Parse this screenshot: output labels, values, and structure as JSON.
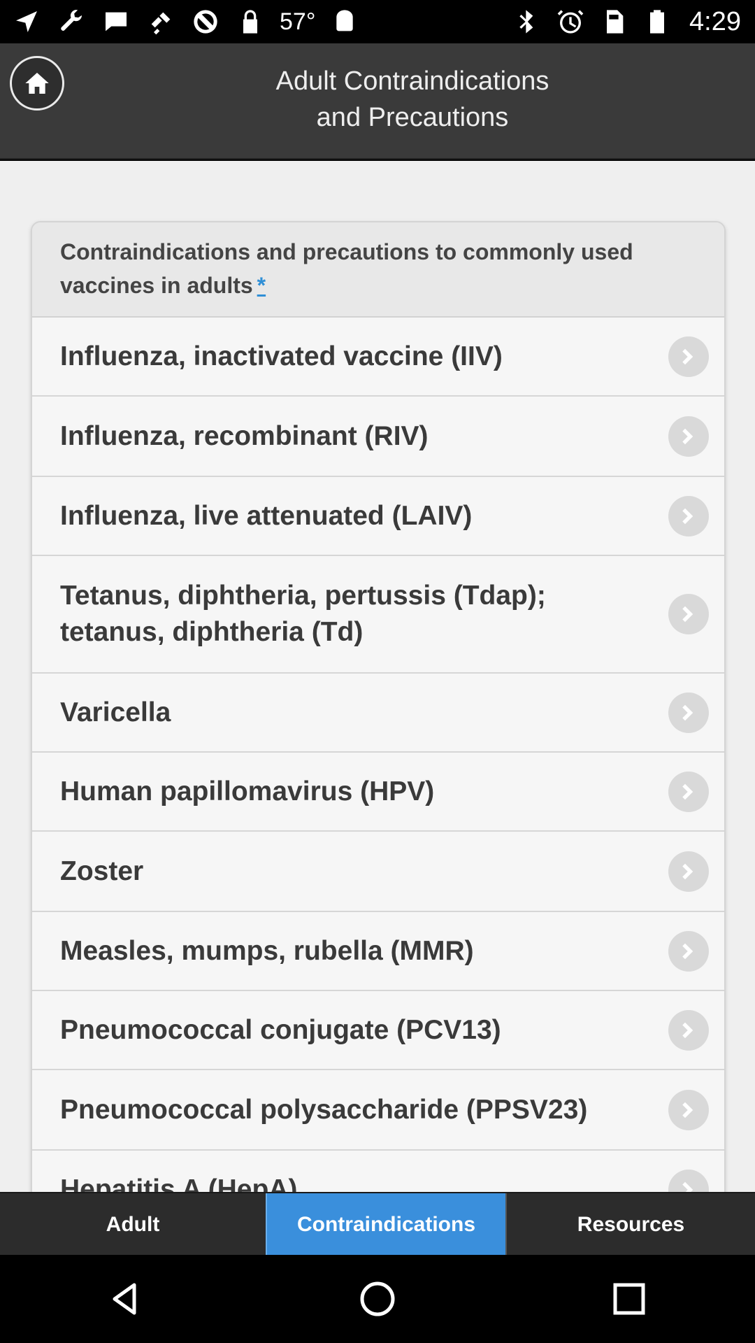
{
  "status_bar": {
    "left_icons": [
      "navigation-icon",
      "wrench-icon",
      "message-icon",
      "satellite-icon",
      "block-icon",
      "lock-icon"
    ],
    "temperature": "57°",
    "right_icons": [
      "bluetooth-icon",
      "alarm-icon",
      "no-sim-icon",
      "battery-icon"
    ],
    "time": "4:29"
  },
  "header": {
    "title_line1": "Adult Contraindications",
    "title_line2": "and Precautions",
    "home_icon": "home-icon"
  },
  "card": {
    "heading": "Contraindications and precautions to commonly used vaccines in adults",
    "asterisk": "*",
    "items": [
      {
        "line1": "Influenza, inactivated vaccine (IIV)",
        "line2": ""
      },
      {
        "line1": "Influenza, recombinant (RIV)",
        "line2": ""
      },
      {
        "line1": "Influenza, live attenuated (LAIV)",
        "line2": ""
      },
      {
        "line1": "Tetanus, diphtheria, pertussis (Tdap);",
        "line2": "tetanus, diphtheria (Td)"
      },
      {
        "line1": "Varicella",
        "line2": ""
      },
      {
        "line1": "Human papillomavirus (HPV)",
        "line2": ""
      },
      {
        "line1": "Zoster",
        "line2": ""
      },
      {
        "line1": "Measles, mumps, rubella (MMR)",
        "line2": ""
      },
      {
        "line1": "Pneumococcal conjugate (PCV13)",
        "line2": ""
      },
      {
        "line1": "Pneumococcal polysaccharide (PPSV23)",
        "line2": ""
      },
      {
        "line1": "Hepatitis A (HepA)",
        "line2": ""
      }
    ]
  },
  "tabs": [
    {
      "label": "Adult"
    },
    {
      "label": "Contraindications",
      "active": true
    },
    {
      "label": "Resources"
    }
  ],
  "nav": {
    "back_icon": "back-icon",
    "home_icon": "home-circle-icon",
    "recents_icon": "recents-square-icon"
  },
  "colors": {
    "accent": "#3a8fdc",
    "header_bg": "#3a3a3a",
    "asterisk": "#2f8fd6"
  }
}
